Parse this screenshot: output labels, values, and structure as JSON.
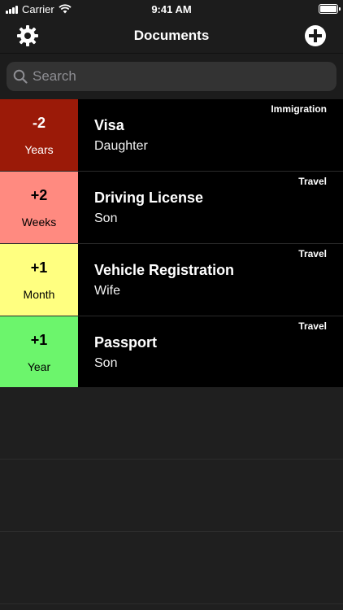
{
  "status_bar": {
    "carrier": "Carrier",
    "time": "9:41 AM"
  },
  "nav": {
    "title": "Documents",
    "left_icon": "gear-icon",
    "right_icon": "plus-circle-icon"
  },
  "search": {
    "placeholder": "Search",
    "value": ""
  },
  "documents": [
    {
      "value": "-2",
      "unit": "Years",
      "title": "Visa",
      "owner": "Daughter",
      "category": "Immigration",
      "color": "#9b1a08",
      "text_color": "#ffffff"
    },
    {
      "value": "+2",
      "unit": "Weeks",
      "title": "Driving License",
      "owner": "Son",
      "category": "Travel",
      "color": "#ff8a80",
      "text_color": "#000000"
    },
    {
      "value": "+1",
      "unit": "Month",
      "title": "Vehicle Registration",
      "owner": "Wife",
      "category": "Travel",
      "color": "#ffff80",
      "text_color": "#000000"
    },
    {
      "value": "+1",
      "unit": "Year",
      "title": "Passport",
      "owner": "Son",
      "category": "Travel",
      "color": "#6cf56c",
      "text_color": "#000000"
    }
  ]
}
